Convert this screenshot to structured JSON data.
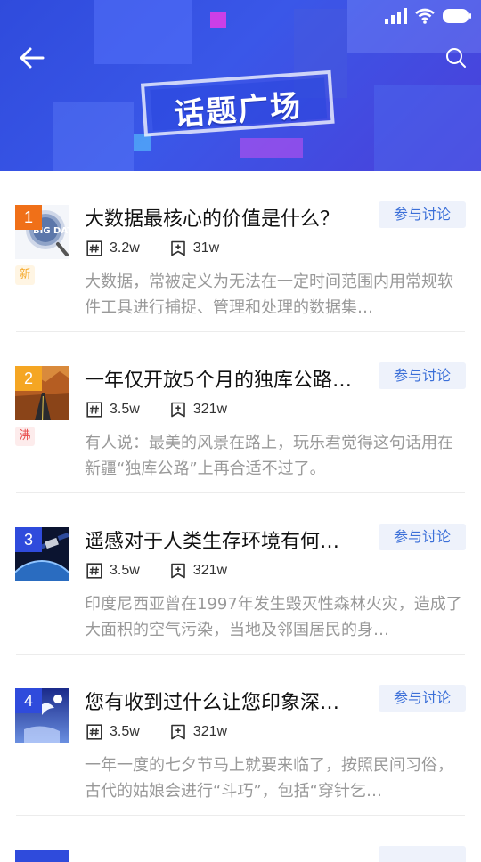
{
  "header": {
    "title": "话题广场",
    "colors": {
      "gradient_start": "#2f4bdc",
      "gradient_end": "#4b3fd9"
    },
    "icons": {
      "back": "arrow-left-icon",
      "search": "search-icon"
    }
  },
  "status_bar": {
    "icons": [
      "signal-icon",
      "wifi-icon",
      "battery-icon"
    ]
  },
  "topics": [
    {
      "rank": "1",
      "rank_color": "#f07018",
      "tag": "新",
      "tag_color": "#f5a623",
      "tag_bg": "#fff5e3",
      "title": "大数据最核心的价值是什么？",
      "join_label": "参与讨论",
      "discussions": "3.2w",
      "favorites": "31w",
      "description": "大数据，常被定义为无法在一定时间范围内用常规软件工具进行捕捉、管理和处理的数据集…",
      "image_icon": "big-data-magnifier-image"
    },
    {
      "rank": "2",
      "rank_color": "#f5a623",
      "tag": "沸",
      "tag_color": "#e84a4a",
      "tag_bg": "#fdecec",
      "title": "一年仅开放5个月的独库公路…",
      "join_label": "参与讨论",
      "discussions": "3.5w",
      "favorites": "321w",
      "description": "有人说：最美的风景在路上，玩乐君觉得这句话用在新疆“独库公路”上再合适不过了。",
      "image_icon": "mountain-road-image"
    },
    {
      "rank": "3",
      "rank_color": "#2f4bdc",
      "tag": "",
      "tag_color": "",
      "tag_bg": "",
      "title": "遥感对于人类生存环境有何…",
      "join_label": "参与讨论",
      "discussions": "3.5w",
      "favorites": "321w",
      "description": "印度尼西亚曾在1997年发生毁灭性森林火灾，造成了大面积的空气污染，当地及邻国居民的身…",
      "image_icon": "satellite-earth-image"
    },
    {
      "rank": "4",
      "rank_color": "#2f4bdc",
      "tag": "",
      "tag_color": "",
      "tag_bg": "",
      "title": "您有收到过什么让您印象深…",
      "join_label": "参与讨论",
      "discussions": "3.5w",
      "favorites": "321w",
      "description": "一年一度的七夕节马上就要来临了，按照民间习俗，古代的姑娘会进行“斗巧”，包括“穿针乞…",
      "image_icon": "night-sky-fairy-image"
    }
  ]
}
